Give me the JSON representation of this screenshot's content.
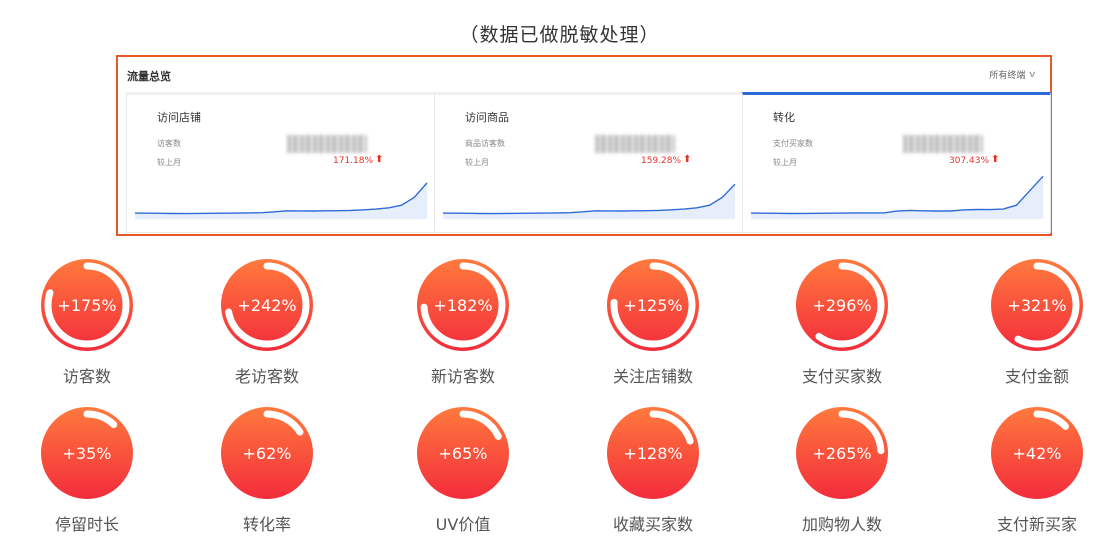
{
  "note": "（数据已做脱敏处理）",
  "overview": {
    "title": "流量总览",
    "terminal_label": "所有终端",
    "cards": [
      {
        "title": "访问店铺",
        "metric_label": "访客数",
        "compare_label": "较上月",
        "change": "171.18%",
        "active": false,
        "trend": [
          6,
          5.8,
          5.6,
          5.4,
          5.2,
          5.5,
          5.7,
          5.8,
          6,
          6.2,
          6.5,
          8,
          9.5,
          9.3,
          9.2,
          9.4,
          9.6,
          10,
          11,
          12,
          14,
          18,
          30,
          52
        ]
      },
      {
        "title": "访问商品",
        "metric_label": "商品访客数",
        "compare_label": "较上月",
        "change": "159.28%",
        "active": false,
        "trend": [
          6,
          5.8,
          5.6,
          5.4,
          5.2,
          5.5,
          5.7,
          5.8,
          6,
          6.2,
          6.5,
          8,
          9.5,
          9.3,
          9.2,
          9.4,
          9.6,
          10,
          11,
          12,
          14,
          18,
          30,
          50
        ]
      },
      {
        "title": "转化",
        "metric_label": "支付买家数",
        "compare_label": "较上月",
        "change": "307.43%",
        "active": true,
        "trend": [
          6,
          5.8,
          5.6,
          5.4,
          5.5,
          5.7,
          5.8,
          6,
          6.2,
          6.3,
          6.3,
          9,
          10,
          9.4,
          9.2,
          9.1,
          10.8,
          11.4,
          11.2,
          12,
          18,
          40,
          62
        ]
      }
    ]
  },
  "stats": [
    {
      "value": "+175%",
      "label": "访客数",
      "fill": 0.8
    },
    {
      "value": "+242%",
      "label": "老访客数",
      "fill": 0.72
    },
    {
      "value": "+182%",
      "label": "新访客数",
      "fill": 0.74
    },
    {
      "value": "+125%",
      "label": "关注店铺数",
      "fill": 0.76
    },
    {
      "value": "+296%",
      "label": "支付买家数",
      "fill": 0.6
    },
    {
      "value": "+321%",
      "label": "支付金额",
      "fill": 0.58
    },
    {
      "value": "+35%",
      "label": "停留时长",
      "fill": 0.12
    },
    {
      "value": "+62%",
      "label": "转化率",
      "fill": 0.16
    },
    {
      "value": "+65%",
      "label": "UV价值",
      "fill": 0.18
    },
    {
      "value": "+128%",
      "label": "收藏买家数",
      "fill": 0.2
    },
    {
      "value": "+265%",
      "label": "加购物人数",
      "fill": 0.24
    },
    {
      "value": "+42%",
      "label": "支付新买家",
      "fill": 0.13
    }
  ],
  "colors": {
    "accent": "#e8572a",
    "active_tab": "#2f6bd8",
    "up": "#e8352c",
    "ring_start": "#ff7a3d",
    "ring_end": "#f32c3c"
  }
}
